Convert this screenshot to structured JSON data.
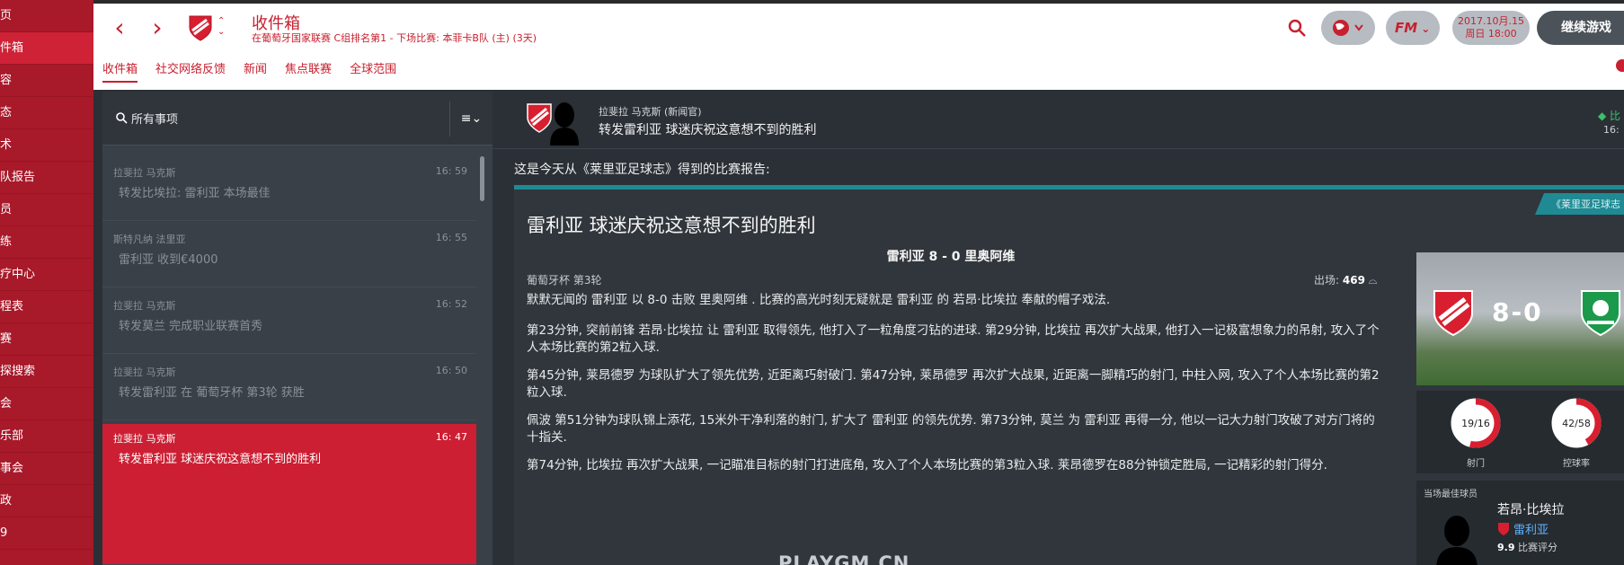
{
  "sidebar": {
    "items": [
      "页",
      "件箱",
      "容",
      "态",
      "术",
      "队报告",
      "员",
      "练",
      "疗中心",
      "程表",
      "赛",
      "探搜索",
      "会",
      "乐部",
      "事会",
      "政",
      "9"
    ],
    "active_index": 1
  },
  "header": {
    "title": "收件箱",
    "subtitle": "在葡萄牙国家联赛 C组排名第1 - 下场比赛: 本菲卡B队 (主) (3天)",
    "tabs": [
      "收件箱",
      "社交网络反馈",
      "新闻",
      "焦点联赛",
      "全球范围"
    ],
    "fm_label": "FM",
    "date_line1": "2017.10月.15",
    "date_line2": "周日 18:00",
    "continue_label": "继续游戏"
  },
  "inbox": {
    "search_label": "所有事项",
    "sort_label": "≡⌄",
    "messages": [
      {
        "from": "拉斐拉 马克斯",
        "time": "16: 59",
        "subject": "转发比埃拉: 雷利亚 本场最佳"
      },
      {
        "from": "斯特凡纳 法里亚",
        "time": "16: 55",
        "subject": "雷利亚 收到€4000"
      },
      {
        "from": "拉斐拉 马克斯",
        "time": "16: 52",
        "subject": "转发莫兰 完成职业联赛首秀"
      },
      {
        "from": "拉斐拉 马克斯",
        "time": "16: 50",
        "subject": "转发雷利亚 在 葡萄牙杯 第3轮 获胜"
      },
      {
        "from": "拉斐拉 马克斯",
        "time": "16: 47",
        "subject": "转发雷利亚 球迷庆祝这意想不到的胜利"
      }
    ],
    "active_index": 4
  },
  "message": {
    "sender": "拉斐拉 马克斯 (新闻官)",
    "subject": "转发雷利亚 球迷庆祝这意想不到的胜利",
    "right_flag": "比",
    "right_num": "16:",
    "intro": "这是今天从《莱里亚足球志》得到的比赛报告:"
  },
  "report": {
    "source": "《莱里亚足球志",
    "title": "雷利亚 球迷庆祝这意想不到的胜利",
    "score_line": "雷利亚 8 - 0 里奥阿维",
    "competition": "葡萄牙杯 第3轮",
    "attendance_label": "出场:",
    "attendance": "469",
    "paragraphs": [
      "默默无闻的 雷利亚 以 8-0 击败 里奥阿维 . 比赛的高光时刻无疑就是 雷利亚 的 若昂·比埃拉 奉献的帽子戏法.",
      "第23分钟, 突前前锋 若昂·比埃拉 让 雷利亚 取得领先, 他打入了一粒角度刁钻的进球. 第29分钟, 比埃拉 再次扩大战果, 他打入一记极富想象力的吊射, 攻入了个人本场比赛的第2粒入球.",
      "第45分钟, 莱昂德罗 为球队扩大了领先优势, 近距离巧射破门. 第47分钟, 莱昂德罗 再次扩大战果, 近距离一脚精巧的射门, 中柱入网, 攻入了个人本场比赛的第2粒入球.",
      "佩波 第51分钟为球队锦上添花, 15米外干净利落的射门, 扩大了 雷利亚 的领先优势. 第73分钟, 莫兰 为 雷利亚 再得一分, 他以一记大力射门攻破了对方门将的十指关.",
      "第74分钟, 比埃拉 再次扩大战果, 一记瞄准目标的射门打进底角, 攻入了个人本场比赛的第3粒入球. 莱昂德罗在88分钟锁定胜局, 一记精彩的射门得分."
    ],
    "watermark": "PLAYGM.CN"
  },
  "score_card": {
    "score": "8-0",
    "home_color": "#d81f2f",
    "away_color": "#1a9a4a"
  },
  "stats": {
    "shots_label": "射门",
    "shots_value": "19/16",
    "shots_fraction": 0.54,
    "poss_label": "控球率",
    "poss_value": "42/58",
    "poss_fraction": 0.42
  },
  "potm": {
    "title": "当场最佳球员",
    "name": "若昂·比埃拉",
    "club": "雷利亚",
    "rating": "9.9",
    "rating_label": "比赛评分"
  }
}
